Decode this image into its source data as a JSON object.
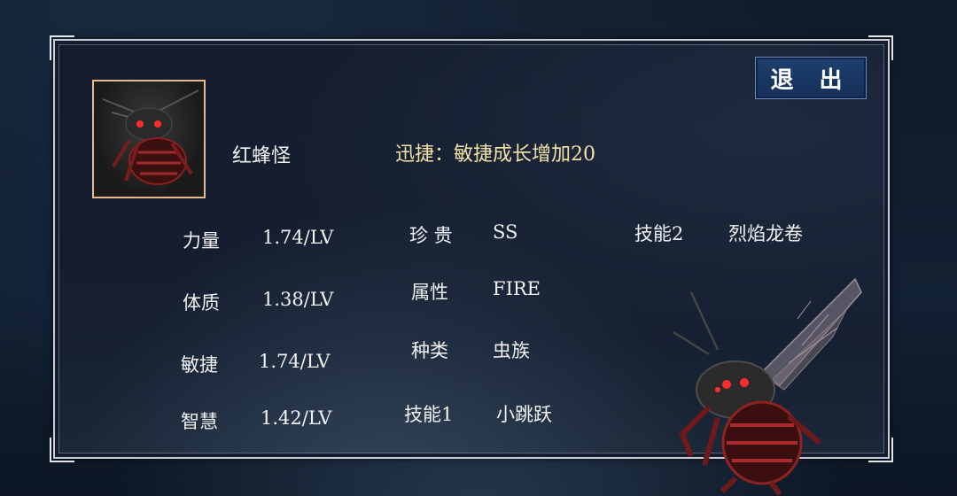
{
  "exit_label": "退 出",
  "monster": {
    "name": "红蜂怪",
    "trait": "迅捷：敏捷成长增加20"
  },
  "stats": [
    {
      "label": "力量",
      "value": "1.74/LV"
    },
    {
      "label": "体质",
      "value": "1.38/LV"
    },
    {
      "label": "敏捷",
      "value": "1.74/LV"
    },
    {
      "label": "智慧",
      "value": "1.42/LV"
    }
  ],
  "info": [
    {
      "label": "珍 贵",
      "value": "SS"
    },
    {
      "label": "属性",
      "value": "FIRE"
    },
    {
      "label": "种类",
      "value": "虫族"
    },
    {
      "label": "技能1",
      "value": "小跳跃"
    }
  ],
  "skill2": {
    "label": "技能2",
    "value": "烈焰龙卷"
  },
  "colors": {
    "trait_text": "#f4e2a6",
    "avatar_border": "#e7b98a",
    "exit_button": "#1e3f6e",
    "panel_bg": "#141d2f"
  }
}
